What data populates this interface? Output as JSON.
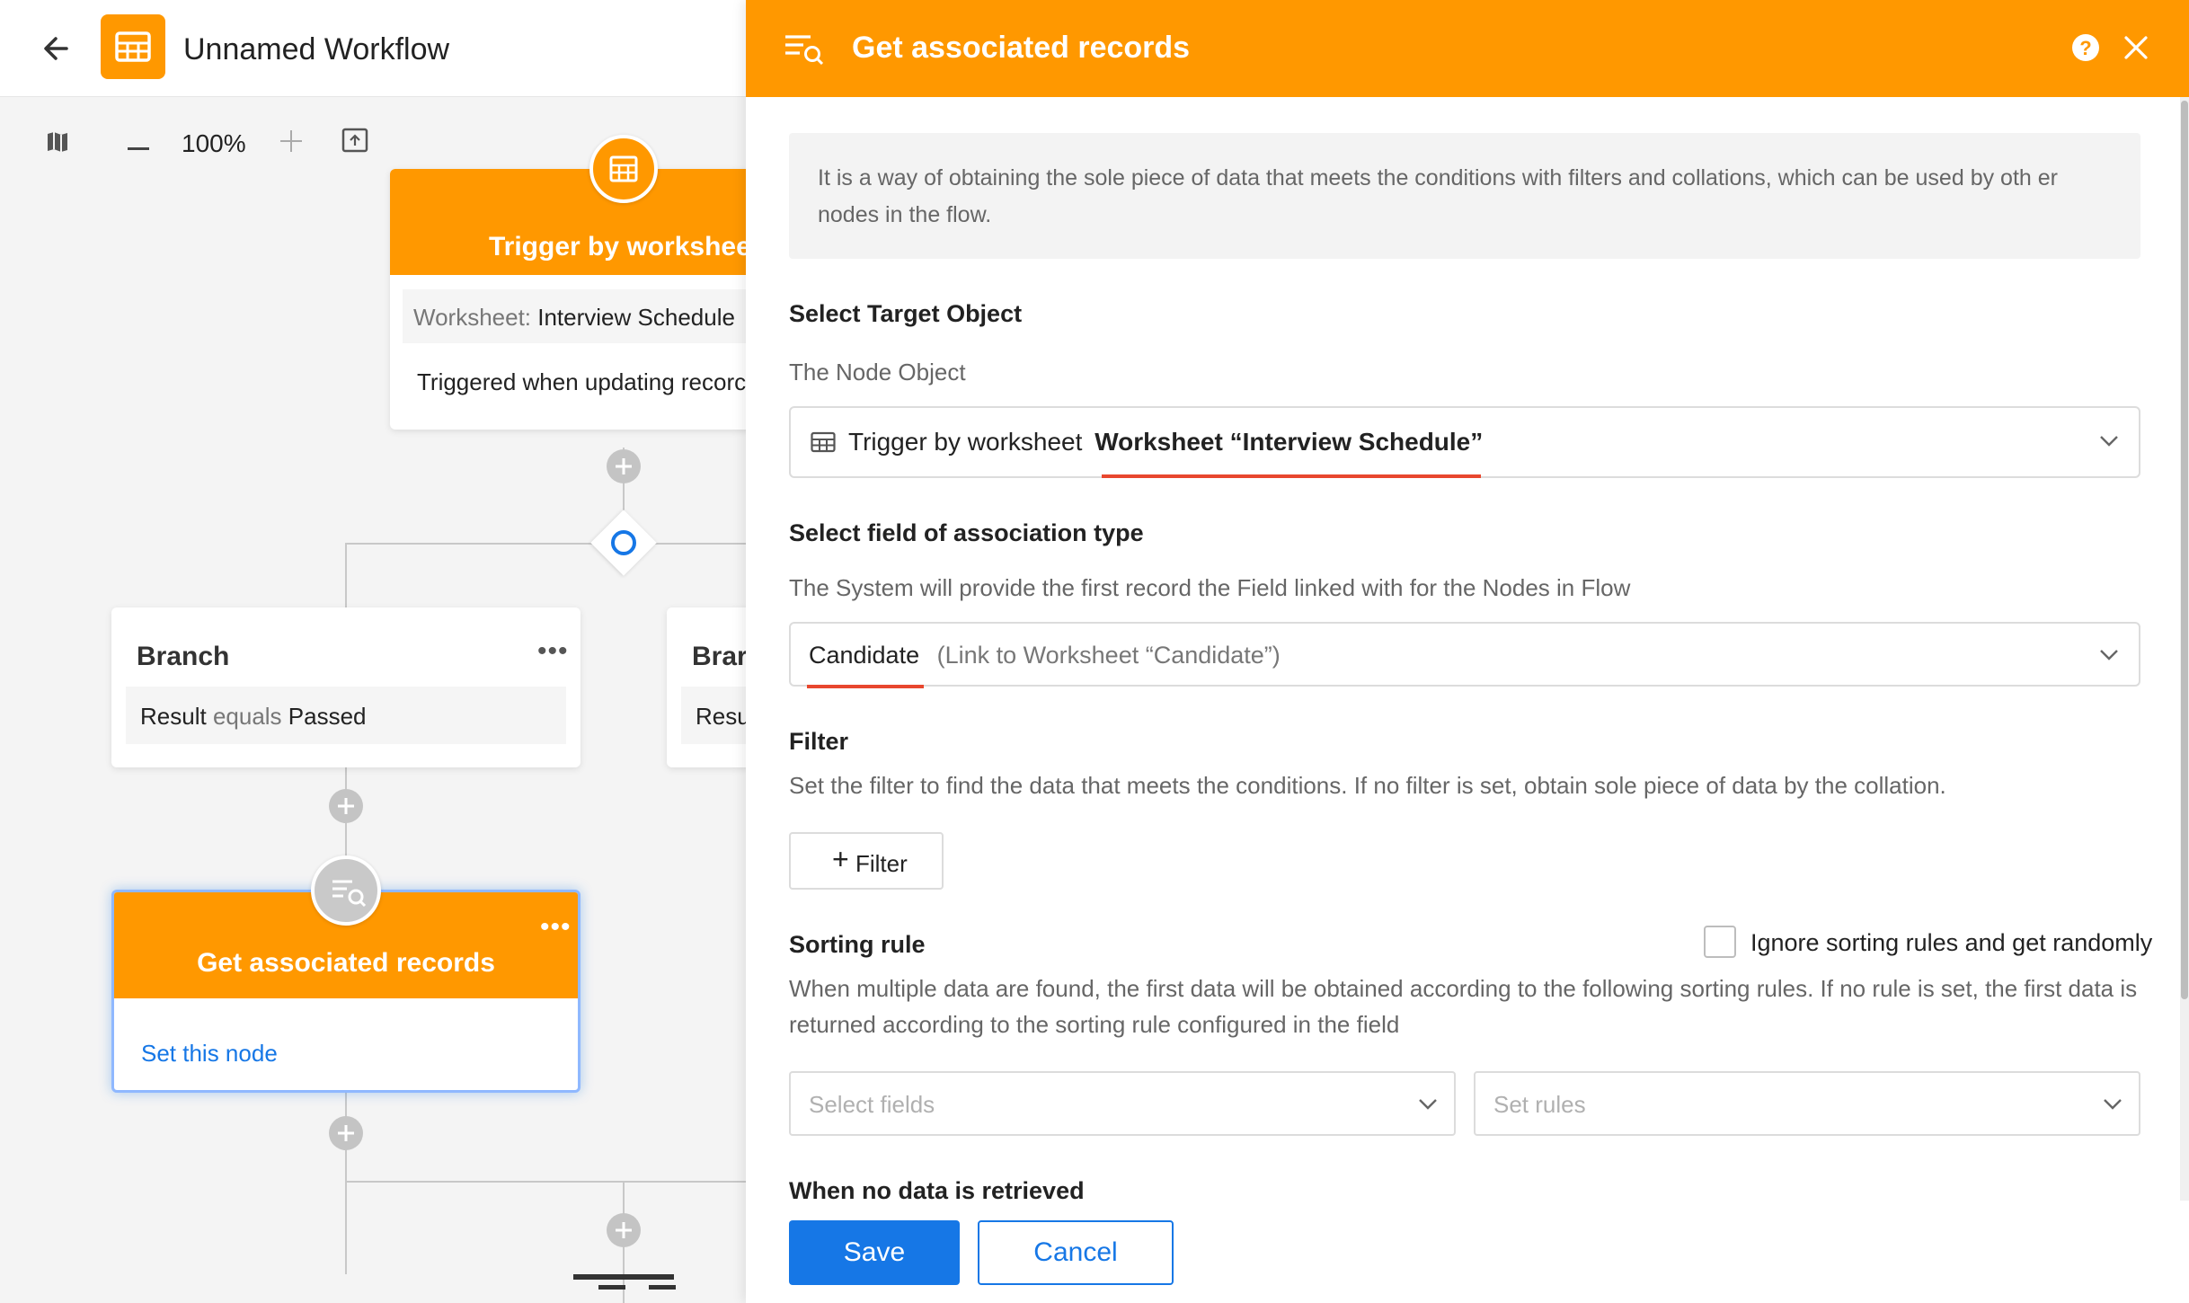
{
  "header": {
    "workflow_title": "Unnamed Workflow"
  },
  "canvas": {
    "zoom_level": "100%",
    "trigger_node": {
      "title": "Trigger by workshee",
      "worksheet_label": "Worksheet:",
      "worksheet_value": "Interview Schedule",
      "trigger_text": "Triggered when updating recorc"
    },
    "branch_node_1": {
      "title": "Branch",
      "field": "Result",
      "operator": "equals",
      "value": "Passed"
    },
    "branch_node_2": {
      "title": "Brar",
      "field": "Resu"
    },
    "get_records_node": {
      "title": "Get associated records",
      "link": "Set this node"
    }
  },
  "panel": {
    "title": "Get associated records",
    "description": "It is a way of obtaining the sole piece of data that meets the conditions with filters and collations, which can be used by oth er nodes in the flow.",
    "target_object": {
      "title": "Select Target Object",
      "subtitle": "The Node Object",
      "prefix": "Trigger by worksheet",
      "value": "Worksheet “Interview Schedule”"
    },
    "association_field": {
      "title": "Select field of association type",
      "subtitle": "The System will provide the first record the Field linked with for the Nodes in Flow",
      "value": "Candidate",
      "hint": "(Link to Worksheet “Candidate”)"
    },
    "filter": {
      "title": "Filter",
      "subtitle": "Set the filter to find the data that meets the conditions. If no filter is set, obtain sole piece of data by the collation.",
      "button_label": "Filter"
    },
    "sorting": {
      "title": "Sorting rule",
      "checkbox_label": "Ignore sorting rules and get randomly",
      "subtitle": "When multiple data are found, the first data will be obtained according to the following sorting rules. If no rule is set, the first data is returned according to the sorting rule configured in the field",
      "fields_placeholder": "Select fields",
      "rules_placeholder": "Set rules"
    },
    "no_data": {
      "title": "When no data is retrieved"
    },
    "footer": {
      "save_label": "Save",
      "cancel_label": "Cancel"
    }
  },
  "colors": {
    "accent_orange": "#ff9800",
    "primary_blue": "#1677e6",
    "highlight_red": "#e8472e"
  }
}
